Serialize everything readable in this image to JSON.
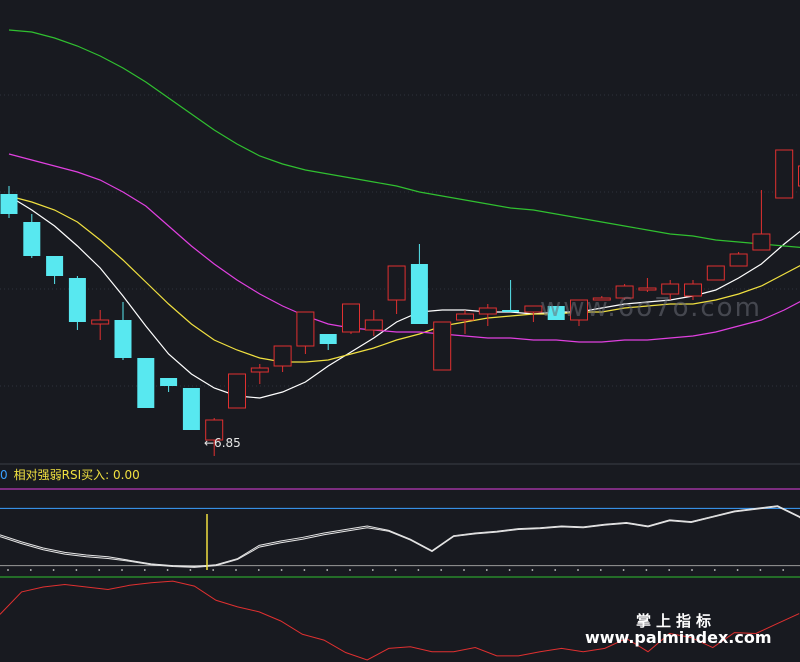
{
  "chart_data": [
    {
      "type": "candlestick",
      "title": "",
      "ylim": [
        6.55,
        8.85
      ],
      "grid": true,
      "low_annotation": "←6.85",
      "candles": [
        {
          "o": 7.88,
          "h": 7.92,
          "l": 7.76,
          "c": 7.78
        },
        {
          "o": 7.74,
          "h": 7.78,
          "l": 7.56,
          "c": 7.57
        },
        {
          "o": 7.57,
          "h": 7.57,
          "l": 7.43,
          "c": 7.47
        },
        {
          "o": 7.46,
          "h": 7.47,
          "l": 7.2,
          "c": 7.24
        },
        {
          "o": 7.23,
          "h": 7.3,
          "l": 7.15,
          "c": 7.25
        },
        {
          "o": 7.25,
          "h": 7.34,
          "l": 7.05,
          "c": 7.06
        },
        {
          "o": 7.06,
          "h": 7.06,
          "l": 6.81,
          "c": 6.81
        },
        {
          "o": 6.96,
          "h": 6.96,
          "l": 6.89,
          "c": 6.92
        },
        {
          "o": 6.91,
          "h": 6.91,
          "l": 6.7,
          "c": 6.7
        },
        {
          "o": 6.65,
          "h": 6.76,
          "l": 6.57,
          "c": 6.75
        },
        {
          "o": 6.81,
          "h": 6.98,
          "l": 6.81,
          "c": 6.98
        },
        {
          "o": 6.99,
          "h": 7.03,
          "l": 6.93,
          "c": 7.01
        },
        {
          "o": 7.02,
          "h": 7.12,
          "l": 6.99,
          "c": 7.12
        },
        {
          "o": 7.12,
          "h": 7.29,
          "l": 7.08,
          "c": 7.29
        },
        {
          "o": 7.18,
          "h": 7.18,
          "l": 7.1,
          "c": 7.13
        },
        {
          "o": 7.19,
          "h": 7.33,
          "l": 7.18,
          "c": 7.33
        },
        {
          "o": 7.2,
          "h": 7.3,
          "l": 7.17,
          "c": 7.25
        },
        {
          "o": 7.35,
          "h": 7.52,
          "l": 7.28,
          "c": 7.52
        },
        {
          "o": 7.53,
          "h": 7.63,
          "l": 7.23,
          "c": 7.23
        },
        {
          "o": 7.0,
          "h": 7.24,
          "l": 7.0,
          "c": 7.24
        },
        {
          "o": 7.25,
          "h": 7.3,
          "l": 7.18,
          "c": 7.28
        },
        {
          "o": 7.28,
          "h": 7.33,
          "l": 7.22,
          "c": 7.31
        },
        {
          "o": 7.3,
          "h": 7.45,
          "l": 7.29,
          "c": 7.29
        },
        {
          "o": 7.29,
          "h": 7.31,
          "l": 7.24,
          "c": 7.32
        },
        {
          "o": 7.32,
          "h": 7.32,
          "l": 7.25,
          "c": 7.25
        },
        {
          "o": 7.25,
          "h": 7.34,
          "l": 7.22,
          "c": 7.35
        },
        {
          "o": 7.35,
          "h": 7.37,
          "l": 7.35,
          "c": 7.36
        },
        {
          "o": 7.36,
          "h": 7.43,
          "l": 7.35,
          "c": 7.42
        },
        {
          "o": 7.41,
          "h": 7.46,
          "l": 7.39,
          "c": 7.41
        },
        {
          "o": 7.38,
          "h": 7.45,
          "l": 7.35,
          "c": 7.43
        },
        {
          "o": 7.37,
          "h": 7.45,
          "l": 7.35,
          "c": 7.43
        },
        {
          "o": 7.45,
          "h": 7.52,
          "l": 7.45,
          "c": 7.52
        },
        {
          "o": 7.52,
          "h": 7.59,
          "l": 7.52,
          "c": 7.58
        },
        {
          "o": 7.6,
          "h": 7.9,
          "l": 7.6,
          "c": 7.68
        },
        {
          "o": 7.86,
          "h": 8.1,
          "l": 7.86,
          "c": 8.1
        },
        {
          "o": 7.92,
          "h": 8.43,
          "l": 7.91,
          "c": 8.02
        },
        {
          "o": 7.86,
          "h": 8.0,
          "l": 7.76,
          "c": 7.93
        },
        {
          "o": 7.96,
          "h": 8.08,
          "l": 7.79,
          "c": 7.86
        }
      ],
      "ma_series": [
        {
          "color": "#ffffff",
          "values": [
            7.87,
            7.8,
            7.72,
            7.62,
            7.51,
            7.37,
            7.22,
            7.08,
            6.98,
            6.91,
            6.87,
            6.86,
            6.89,
            6.94,
            7.02,
            7.09,
            7.16,
            7.24,
            7.29,
            7.3,
            7.3,
            7.29,
            7.29,
            7.28,
            7.29,
            7.29,
            7.31,
            7.33,
            7.34,
            7.35,
            7.37,
            7.4,
            7.46,
            7.53,
            7.63,
            7.72,
            7.79,
            7.83
          ]
        },
        {
          "color": "#f0e040",
          "values": [
            7.87,
            7.84,
            7.8,
            7.74,
            7.65,
            7.55,
            7.44,
            7.33,
            7.23,
            7.15,
            7.1,
            7.06,
            7.04,
            7.04,
            7.05,
            7.08,
            7.11,
            7.15,
            7.18,
            7.22,
            7.24,
            7.26,
            7.27,
            7.28,
            7.28,
            7.29,
            7.29,
            7.31,
            7.32,
            7.33,
            7.33,
            7.35,
            7.38,
            7.42,
            7.48,
            7.54,
            7.61,
            7.66
          ]
        },
        {
          "color": "#e040e0",
          "values": [
            8.08,
            8.05,
            8.02,
            7.99,
            7.95,
            7.89,
            7.82,
            7.72,
            7.62,
            7.53,
            7.45,
            7.38,
            7.32,
            7.27,
            7.23,
            7.21,
            7.2,
            7.19,
            7.19,
            7.18,
            7.17,
            7.16,
            7.16,
            7.15,
            7.15,
            7.14,
            7.14,
            7.15,
            7.15,
            7.16,
            7.17,
            7.19,
            7.22,
            7.25,
            7.3,
            7.36,
            7.43,
            7.48
          ]
        },
        {
          "color": "#30c030",
          "values": [
            8.7,
            8.69,
            8.66,
            8.62,
            8.57,
            8.51,
            8.44,
            8.36,
            8.28,
            8.2,
            8.13,
            8.07,
            8.03,
            8.0,
            7.98,
            7.96,
            7.94,
            7.92,
            7.89,
            7.87,
            7.85,
            7.83,
            7.81,
            7.8,
            7.78,
            7.76,
            7.74,
            7.72,
            7.7,
            7.68,
            7.67,
            7.65,
            7.64,
            7.63,
            7.62,
            7.61,
            7.6,
            7.59
          ]
        }
      ]
    },
    {
      "type": "line",
      "title": "相对强弱RSI买入: 0.00",
      "label_prefix": "0",
      "label_name": "相对强弱RSI买入: ",
      "label_value": "0.00",
      "ylim": [
        0,
        100
      ],
      "reference_lines": [
        {
          "value": 92,
          "color": "#e040e0"
        },
        {
          "value": 70,
          "color": "#3aa0ff"
        },
        {
          "value": 5,
          "color": "#9a9a9a"
        }
      ],
      "signal_index": 9,
      "series": [
        {
          "color": "#e6e6e6",
          "values": [
            40,
            32,
            25,
            20,
            17,
            15,
            11,
            7,
            5,
            4,
            6,
            13,
            28,
            33,
            37,
            42,
            46,
            50,
            45,
            35,
            22,
            39,
            42,
            44,
            47,
            48,
            50,
            49,
            52,
            54,
            50,
            57,
            55,
            61,
            67,
            70,
            73,
            61,
            46
          ]
        },
        {
          "color": "#e6e6e6",
          "values": [
            38,
            30,
            23,
            18,
            15,
            13,
            10,
            6,
            4,
            3,
            5,
            12,
            26,
            31,
            35,
            40,
            44,
            48,
            44,
            34,
            21,
            38,
            41,
            43,
            46,
            47,
            49,
            48,
            51,
            53,
            49,
            56,
            54,
            60,
            66,
            69,
            72,
            60,
            44
          ]
        }
      ]
    },
    {
      "type": "line",
      "title": "",
      "ylim": [
        0,
        100
      ],
      "reference_lines": [
        {
          "value": 100,
          "color": "#30c030"
        }
      ],
      "series": [
        {
          "color": "#e03030",
          "values": [
            55,
            82,
            88,
            91,
            88,
            85,
            90,
            93,
            95,
            89,
            72,
            64,
            58,
            47,
            31,
            24,
            9,
            -5,
            14,
            16,
            10,
            10,
            15,
            5,
            5,
            10,
            14,
            10,
            14,
            26,
            10,
            32,
            27,
            15,
            33,
            32,
            44,
            56
          ]
        }
      ]
    }
  ],
  "watermark": "www.6o7o.com",
  "brand": {
    "name": "掌上指标",
    "url": "www.palmindex.com"
  },
  "colors": {
    "up": "#e03030",
    "down": "#58e8f0",
    "background": "#181a20",
    "grid": "#2e323b"
  }
}
